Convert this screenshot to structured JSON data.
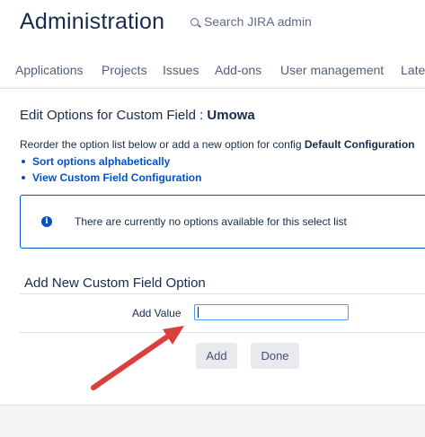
{
  "header": {
    "title": "Administration",
    "search_placeholder": "Search JIRA admin"
  },
  "nav": {
    "items": [
      "Applications",
      "Projects",
      "Issues",
      "Add-ons",
      "User management",
      "Latest"
    ]
  },
  "edit": {
    "title_prefix": "Edit Options for Custom Field : ",
    "field_name": "Umowa",
    "desc_prefix": "Reorder the option list below or add a new option for config ",
    "desc_config": "Default Configuration",
    "links": [
      "Sort options alphabetically",
      "View Custom Field Configuration"
    ]
  },
  "info": {
    "message": "There are currently no options available for this select list"
  },
  "add_option": {
    "title": "Add New Custom Field Option",
    "value_label": "Add Value",
    "value": "",
    "add_button": "Add",
    "done_button": "Done"
  },
  "colors": {
    "accent": "#0052cc",
    "annotation_arrow": "#d9413c"
  }
}
